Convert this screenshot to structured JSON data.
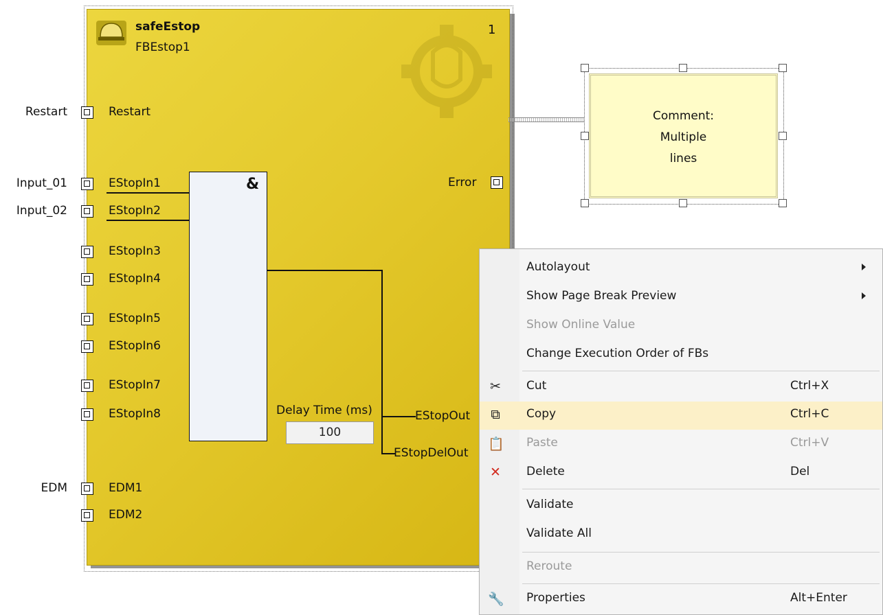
{
  "function_block": {
    "type": "safeEstop",
    "instance": "FBEstop1",
    "order": "1",
    "and_symbol": "&",
    "inputs": [
      {
        "ext": "Restart",
        "port": "Restart"
      },
      {
        "ext": "Input_01",
        "port": "EStopIn1"
      },
      {
        "ext": "Input_02",
        "port": "EStopIn2"
      },
      {
        "ext": "",
        "port": "EStopIn3"
      },
      {
        "ext": "",
        "port": "EStopIn4"
      },
      {
        "ext": "",
        "port": "EStopIn5"
      },
      {
        "ext": "",
        "port": "EStopIn6"
      },
      {
        "ext": "",
        "port": "EStopIn7"
      },
      {
        "ext": "",
        "port": "EStopIn8"
      },
      {
        "ext": "EDM",
        "port": "EDM1"
      },
      {
        "ext": "",
        "port": "EDM2"
      }
    ],
    "error_output": "Error",
    "delay_label": "Delay Time (ms)",
    "delay_value": "100",
    "outputs": [
      "EStopOut",
      "EStopDelOut"
    ]
  },
  "comment": {
    "line1": "Comment:",
    "line2": "Multiple",
    "line3": "lines"
  },
  "context_menu": {
    "items": [
      {
        "label": "Autolayout",
        "shortcut": "",
        "icon": "",
        "submenu": true,
        "disabled": false
      },
      {
        "label": "Show Page Break Preview",
        "shortcut": "",
        "icon": "",
        "submenu": true,
        "disabled": false
      },
      {
        "label": "Show Online Value",
        "shortcut": "",
        "icon": "",
        "submenu": false,
        "disabled": true
      },
      {
        "label": "Change Execution Order of FBs",
        "shortcut": "",
        "icon": "",
        "submenu": false,
        "disabled": false
      },
      {
        "label": "Cut",
        "shortcut": "Ctrl+X",
        "icon": "scissors-icon",
        "submenu": false,
        "disabled": false
      },
      {
        "label": "Copy",
        "shortcut": "Ctrl+C",
        "icon": "copy-icon",
        "submenu": false,
        "disabled": false,
        "hovered": true
      },
      {
        "label": "Paste",
        "shortcut": "Ctrl+V",
        "icon": "paste-icon",
        "submenu": false,
        "disabled": true
      },
      {
        "label": "Delete",
        "shortcut": "Del",
        "icon": "delete-x-icon",
        "submenu": false,
        "disabled": false
      },
      {
        "label": "Validate",
        "shortcut": "",
        "icon": "",
        "submenu": false,
        "disabled": false
      },
      {
        "label": "Validate All",
        "shortcut": "",
        "icon": "",
        "submenu": false,
        "disabled": false
      },
      {
        "label": "Reroute",
        "shortcut": "",
        "icon": "",
        "submenu": false,
        "disabled": true
      },
      {
        "label": "Properties",
        "shortcut": "Alt+Enter",
        "icon": "wrench-icon",
        "submenu": false,
        "disabled": false
      }
    ]
  },
  "colors": {
    "block_yellow": "#e4c92c",
    "comment_bg": "#fffcc8",
    "menu_hover": "#fcf0c8",
    "delete_red": "#d22b1f"
  }
}
